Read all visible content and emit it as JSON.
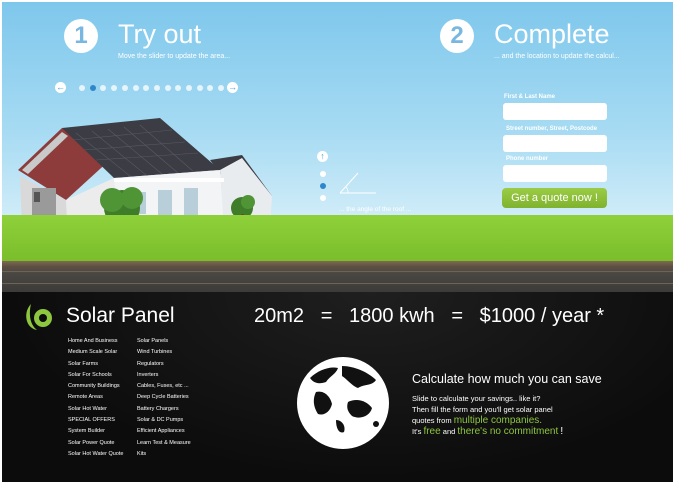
{
  "steps": [
    {
      "number": "1",
      "title": "Try out",
      "subtitle": "Move the slider to update the area..."
    },
    {
      "number": "2",
      "title": "Complete",
      "subtitle": "... and the location to update the calcul..."
    }
  ],
  "slider": {
    "prev_icon": "left-arrow-icon",
    "next_icon": "right-arrow-icon",
    "dot_count": 14,
    "active_dot": 1
  },
  "roof": {
    "label": "... the angle of the roof ...",
    "up_icon": "up-arrow-icon",
    "down_icon": "down-arrow-icon",
    "active_index": 1
  },
  "form": {
    "name_label": "First & Last Name",
    "address_label": "Street number, Street, Postcode",
    "phone_label": "Phone number",
    "name_value": "",
    "address_value": "",
    "phone_value": "",
    "submit_label": "Get a quote now !"
  },
  "brand": {
    "name": "Solar Panel",
    "logo_icon": "leaf-logo-icon"
  },
  "equation": "20m2   =   1800 kwh   =   $1000 / year *",
  "links_left": [
    "Home And Business",
    "Medium Scale Solar",
    "Solar Farms",
    "Solar For Schools",
    "Community Buildings",
    "Remote Areas",
    "Solar Hot Water",
    "SPECIAL OFFERS",
    "System Builder",
    "Solar Power Quote",
    "Solar Hot Water Quote"
  ],
  "links_right": [
    "Solar Panels",
    "Wind Turbines",
    "Regulators",
    "Inverters",
    "Cables, Fuses, etc ...",
    "Deep Cycle Batteries",
    "Battery Chargers",
    "Solar & DC Pumps",
    "Efficient Appliances",
    "Learn Test & Measure",
    "Kits"
  ],
  "calc": {
    "title": "Calculate how much you can save",
    "line1": "Slide to calculate your savings.. like it?",
    "line2": "Then fill the form and you'll get solar panel",
    "line3_prefix": "quotes from",
    "line3_highlight": "multiple companies.",
    "line4_prefix": "It's",
    "line4_free": "free",
    "line4_and": "and",
    "line4_highlight": "there's no commitment",
    "line4_suffix": "!"
  },
  "colors": {
    "accent_green": "#8dc63f",
    "sky_blue": "#7ec7ec",
    "active_dot": "#2f86c8"
  }
}
